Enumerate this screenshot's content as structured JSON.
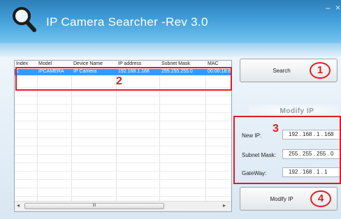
{
  "window": {
    "title": "IP Camera Searcher -Rev 3.0",
    "minimize_glyph": "–",
    "close_glyph": "×",
    "logo_icon": "magnifier-icon"
  },
  "list": {
    "columns": [
      "Index",
      "Model",
      "Device Name",
      "IP address",
      "Subnet Mask",
      "MAC"
    ],
    "rows": [
      {
        "index": "1",
        "model": "IPCAMERA",
        "device_name": "IP Camera",
        "ip": "192.168.1.168",
        "subnet": "255.255.255.0",
        "mac": "00:00:18:8"
      }
    ],
    "scroll_left": "◂",
    "scroll_right": "▸",
    "scroll_grip": "III"
  },
  "buttons": {
    "search_label": "Search",
    "modify_ip_label": "Modify IP"
  },
  "modify_panel": {
    "title": "Modify IP",
    "new_ip_label": "New IP:",
    "new_ip_value": "192 . 168 .  1  . 168",
    "subnet_label": "Subnet Mask:",
    "subnet_value": "255 . 255 . 255 .  0",
    "gateway_label": "GateWay:",
    "gateway_value": "192 . 168 .  1  .  1"
  },
  "annotations": {
    "n1": "1",
    "n2": "2",
    "n3": "3",
    "n4": "4",
    "color": "#e21b23"
  },
  "colors": {
    "title_bar": "#3f9bd6",
    "selection": "#3399ff"
  }
}
